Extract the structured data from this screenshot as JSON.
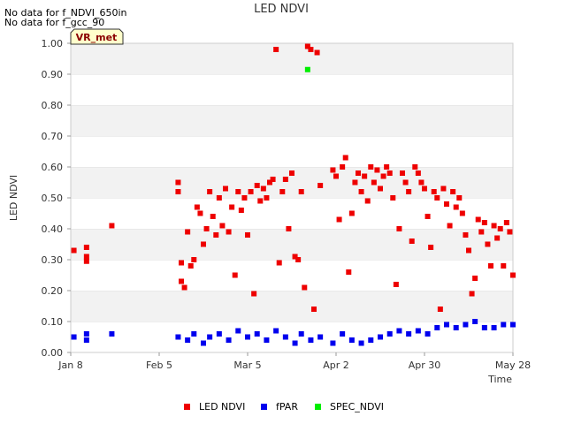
{
  "notices": [
    "No data for f_NDVI_650in",
    "No data for f_gcc_90"
  ],
  "badge": "VR_met",
  "chart_data": {
    "type": "scatter",
    "title": "LED NDVI",
    "xlabel": "Time",
    "ylabel": "LED NDVI",
    "xlim": [
      "2025-01-08",
      "2025-05-28"
    ],
    "ylim": [
      0.0,
      1.0
    ],
    "y_ticks": [
      "0.00",
      "0.10",
      "0.20",
      "0.30",
      "0.40",
      "0.50",
      "0.60",
      "0.70",
      "0.80",
      "0.90",
      "1.00"
    ],
    "x_ticks": [
      {
        "date": "2025-01-08",
        "label": "Jan 8"
      },
      {
        "date": "2025-02-05",
        "label": "Feb 5"
      },
      {
        "date": "2025-03-05",
        "label": "Mar 5"
      },
      {
        "date": "2025-04-02",
        "label": "Apr 2"
      },
      {
        "date": "2025-04-30",
        "label": "Apr 30"
      },
      {
        "date": "2025-05-28",
        "label": "May 28"
      }
    ],
    "grid": "alternating-bands",
    "legend_position": "bottom",
    "series": [
      {
        "name": "LED NDVI",
        "color": "#ee0000",
        "points": [
          [
            "2025-01-09",
            0.33
          ],
          [
            "2025-01-13",
            0.34
          ],
          [
            "2025-01-13",
            0.31
          ],
          [
            "2025-01-13",
            0.295
          ],
          [
            "2025-01-21",
            0.41
          ],
          [
            "2025-02-11",
            0.55
          ],
          [
            "2025-02-11",
            0.52
          ],
          [
            "2025-02-12",
            0.29
          ],
          [
            "2025-02-12",
            0.23
          ],
          [
            "2025-02-13",
            0.21
          ],
          [
            "2025-02-14",
            0.39
          ],
          [
            "2025-02-15",
            0.28
          ],
          [
            "2025-02-16",
            0.3
          ],
          [
            "2025-02-17",
            0.47
          ],
          [
            "2025-02-18",
            0.45
          ],
          [
            "2025-02-19",
            0.35
          ],
          [
            "2025-02-20",
            0.4
          ],
          [
            "2025-02-21",
            0.52
          ],
          [
            "2025-02-22",
            0.44
          ],
          [
            "2025-02-23",
            0.38
          ],
          [
            "2025-02-24",
            0.5
          ],
          [
            "2025-02-25",
            0.41
          ],
          [
            "2025-02-26",
            0.53
          ],
          [
            "2025-02-27",
            0.39
          ],
          [
            "2025-02-28",
            0.47
          ],
          [
            "2025-03-01",
            0.25
          ],
          [
            "2025-03-02",
            0.52
          ],
          [
            "2025-03-03",
            0.46
          ],
          [
            "2025-03-04",
            0.5
          ],
          [
            "2025-03-05",
            0.38
          ],
          [
            "2025-03-06",
            0.52
          ],
          [
            "2025-03-07",
            0.19
          ],
          [
            "2025-03-08",
            0.54
          ],
          [
            "2025-03-09",
            0.49
          ],
          [
            "2025-03-10",
            0.53
          ],
          [
            "2025-03-11",
            0.5
          ],
          [
            "2025-03-12",
            0.55
          ],
          [
            "2025-03-13",
            0.56
          ],
          [
            "2025-03-14",
            0.98
          ],
          [
            "2025-03-15",
            0.29
          ],
          [
            "2025-03-16",
            0.52
          ],
          [
            "2025-03-17",
            0.56
          ],
          [
            "2025-03-18",
            0.4
          ],
          [
            "2025-03-19",
            0.58
          ],
          [
            "2025-03-20",
            0.31
          ],
          [
            "2025-03-21",
            0.3
          ],
          [
            "2025-03-22",
            0.52
          ],
          [
            "2025-03-23",
            0.21
          ],
          [
            "2025-03-24",
            0.99
          ],
          [
            "2025-03-25",
            0.98
          ],
          [
            "2025-03-26",
            0.14
          ],
          [
            "2025-03-27",
            0.97
          ],
          [
            "2025-03-28",
            0.54
          ],
          [
            "2025-04-01",
            0.59
          ],
          [
            "2025-04-02",
            0.57
          ],
          [
            "2025-04-03",
            0.43
          ],
          [
            "2025-04-04",
            0.6
          ],
          [
            "2025-04-05",
            0.63
          ],
          [
            "2025-04-06",
            0.26
          ],
          [
            "2025-04-07",
            0.45
          ],
          [
            "2025-04-08",
            0.55
          ],
          [
            "2025-04-09",
            0.58
          ],
          [
            "2025-04-10",
            0.52
          ],
          [
            "2025-04-11",
            0.57
          ],
          [
            "2025-04-12",
            0.49
          ],
          [
            "2025-04-13",
            0.6
          ],
          [
            "2025-04-14",
            0.55
          ],
          [
            "2025-04-15",
            0.59
          ],
          [
            "2025-04-16",
            0.53
          ],
          [
            "2025-04-17",
            0.57
          ],
          [
            "2025-04-18",
            0.6
          ],
          [
            "2025-04-19",
            0.58
          ],
          [
            "2025-04-20",
            0.5
          ],
          [
            "2025-04-21",
            0.22
          ],
          [
            "2025-04-22",
            0.4
          ],
          [
            "2025-04-23",
            0.58
          ],
          [
            "2025-04-24",
            0.55
          ],
          [
            "2025-04-25",
            0.52
          ],
          [
            "2025-04-26",
            0.36
          ],
          [
            "2025-04-27",
            0.6
          ],
          [
            "2025-04-28",
            0.58
          ],
          [
            "2025-04-29",
            0.55
          ],
          [
            "2025-04-30",
            0.53
          ],
          [
            "2025-05-01",
            0.44
          ],
          [
            "2025-05-02",
            0.34
          ],
          [
            "2025-05-03",
            0.52
          ],
          [
            "2025-05-04",
            0.5
          ],
          [
            "2025-05-05",
            0.14
          ],
          [
            "2025-05-06",
            0.53
          ],
          [
            "2025-05-07",
            0.48
          ],
          [
            "2025-05-08",
            0.41
          ],
          [
            "2025-05-09",
            0.52
          ],
          [
            "2025-05-10",
            0.47
          ],
          [
            "2025-05-11",
            0.5
          ],
          [
            "2025-05-12",
            0.45
          ],
          [
            "2025-05-13",
            0.38
          ],
          [
            "2025-05-14",
            0.33
          ],
          [
            "2025-05-15",
            0.19
          ],
          [
            "2025-05-16",
            0.24
          ],
          [
            "2025-05-17",
            0.43
          ],
          [
            "2025-05-18",
            0.39
          ],
          [
            "2025-05-19",
            0.42
          ],
          [
            "2025-05-20",
            0.35
          ],
          [
            "2025-05-21",
            0.28
          ],
          [
            "2025-05-22",
            0.41
          ],
          [
            "2025-05-23",
            0.37
          ],
          [
            "2025-05-24",
            0.4
          ],
          [
            "2025-05-25",
            0.28
          ],
          [
            "2025-05-26",
            0.42
          ],
          [
            "2025-05-27",
            0.39
          ],
          [
            "2025-05-28",
            0.25
          ]
        ]
      },
      {
        "name": "fPAR",
        "color": "#0000ee",
        "points": [
          [
            "2025-01-09",
            0.05
          ],
          [
            "2025-01-13",
            0.06
          ],
          [
            "2025-01-13",
            0.04
          ],
          [
            "2025-01-21",
            0.06
          ],
          [
            "2025-02-11",
            0.05
          ],
          [
            "2025-02-14",
            0.04
          ],
          [
            "2025-02-16",
            0.06
          ],
          [
            "2025-02-19",
            0.03
          ],
          [
            "2025-02-21",
            0.05
          ],
          [
            "2025-02-24",
            0.06
          ],
          [
            "2025-02-27",
            0.04
          ],
          [
            "2025-03-02",
            0.07
          ],
          [
            "2025-03-05",
            0.05
          ],
          [
            "2025-03-08",
            0.06
          ],
          [
            "2025-03-11",
            0.04
          ],
          [
            "2025-03-14",
            0.07
          ],
          [
            "2025-03-17",
            0.05
          ],
          [
            "2025-03-20",
            0.03
          ],
          [
            "2025-03-22",
            0.06
          ],
          [
            "2025-03-25",
            0.04
          ],
          [
            "2025-03-28",
            0.05
          ],
          [
            "2025-04-01",
            0.03
          ],
          [
            "2025-04-04",
            0.06
          ],
          [
            "2025-04-07",
            0.04
          ],
          [
            "2025-04-10",
            0.03
          ],
          [
            "2025-04-13",
            0.04
          ],
          [
            "2025-04-16",
            0.05
          ],
          [
            "2025-04-19",
            0.06
          ],
          [
            "2025-04-22",
            0.07
          ],
          [
            "2025-04-25",
            0.06
          ],
          [
            "2025-04-28",
            0.07
          ],
          [
            "2025-05-01",
            0.06
          ],
          [
            "2025-05-04",
            0.08
          ],
          [
            "2025-05-07",
            0.09
          ],
          [
            "2025-05-10",
            0.08
          ],
          [
            "2025-05-13",
            0.09
          ],
          [
            "2025-05-16",
            0.1
          ],
          [
            "2025-05-19",
            0.08
          ],
          [
            "2025-05-22",
            0.08
          ],
          [
            "2025-05-25",
            0.09
          ],
          [
            "2025-05-28",
            0.09
          ]
        ]
      },
      {
        "name": "SPEC_NDVI",
        "color": "#00ee00",
        "points": [
          [
            "2025-03-24",
            0.915
          ]
        ]
      }
    ]
  }
}
